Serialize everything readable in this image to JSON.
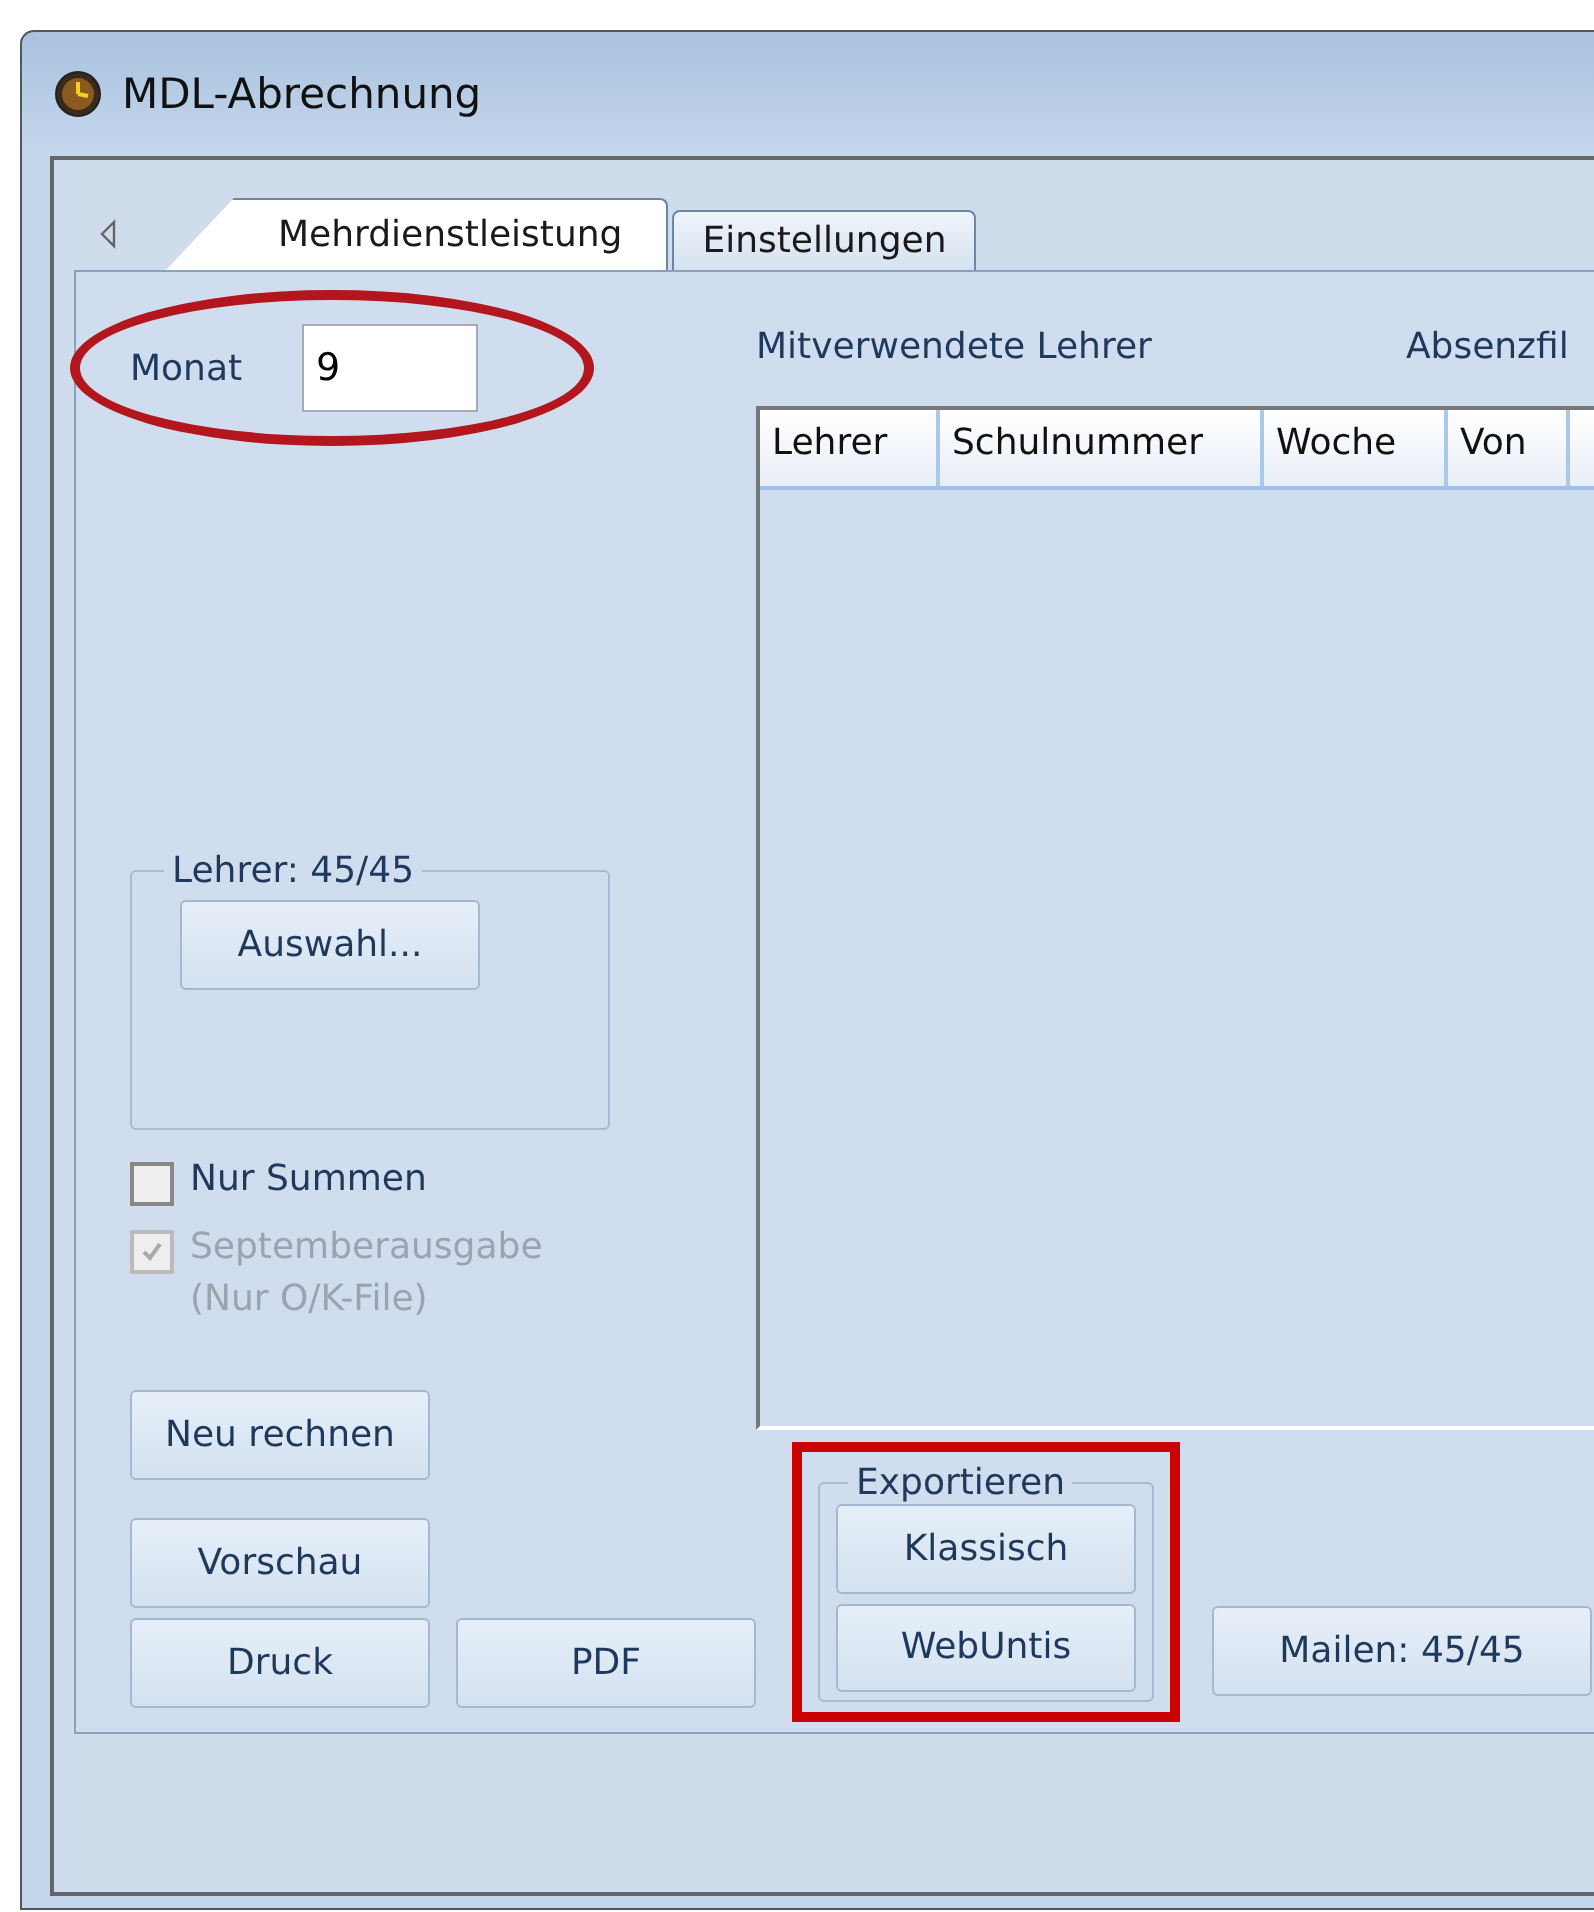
{
  "window": {
    "title": "MDL-Abrechnung"
  },
  "tabs": [
    {
      "label": "Mehrdienstleistung",
      "selected": true
    },
    {
      "label": "Einstellungen",
      "selected": false
    }
  ],
  "monat": {
    "label": "Monat",
    "value": "9",
    "highlighted": true
  },
  "lehrer_group": {
    "title": "Lehrer: 45/45",
    "button": "Auswahl..."
  },
  "checkboxes": [
    {
      "label": "Nur Summen",
      "checked": false,
      "disabled": false
    },
    {
      "label": "Septemberausgabe (Nur O/K-File)",
      "checked": true,
      "disabled": true
    }
  ],
  "left_buttons": [
    [
      "Neu rechnen"
    ],
    [
      "Vorschau"
    ],
    [
      "Druck",
      "PDF"
    ]
  ],
  "labels": [
    "Mitverwendete Lehrer",
    "Absenzfil"
  ],
  "table": {
    "columns": [
      "Lehrer",
      "Schulnummer",
      "Woche",
      "Von"
    ]
  },
  "export_group": {
    "title": "Exportieren",
    "buttons": [
      "Klassisch",
      "WebUntis"
    ],
    "highlighted": true
  },
  "mail_button": "Mailen: 45/45"
}
